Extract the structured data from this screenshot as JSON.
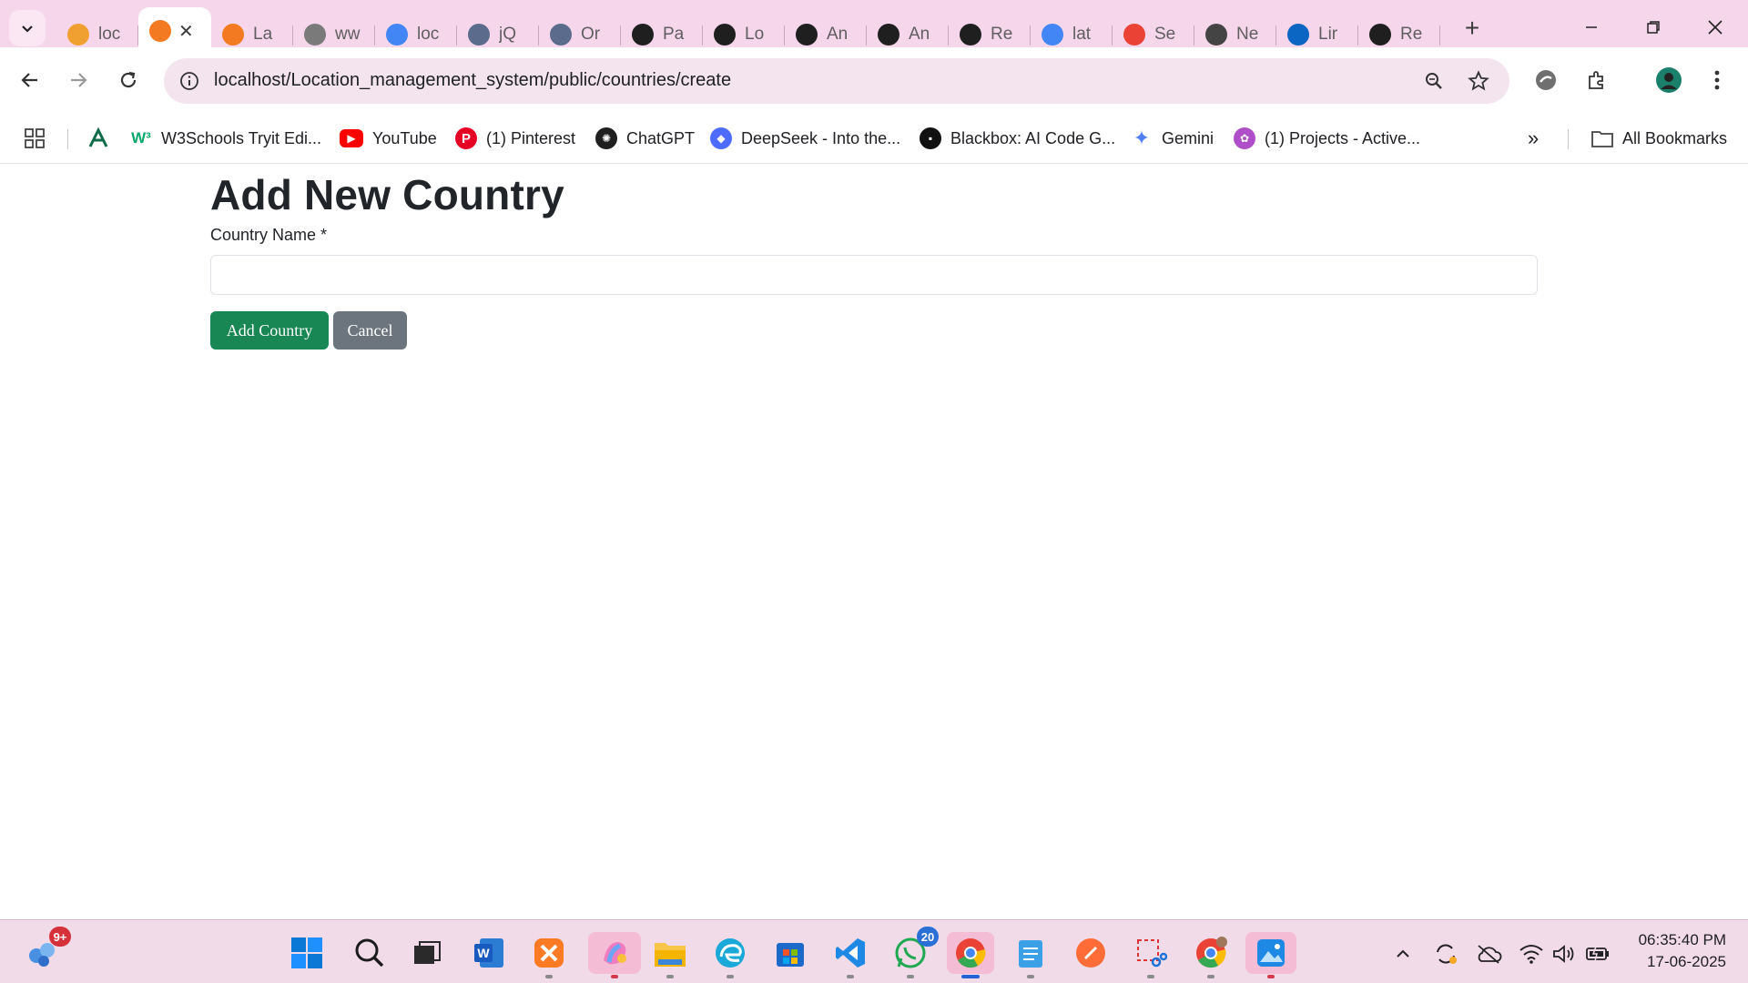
{
  "browser": {
    "tabs": [
      {
        "title": "loc",
        "icon": "phpmyadmin-icon",
        "color": "#f0a030"
      },
      {
        "title": "",
        "icon": "xampp-icon",
        "color": "#f37a20",
        "active": true
      },
      {
        "title": "La",
        "icon": "xampp-icon",
        "color": "#f37a20"
      },
      {
        "title": "ww",
        "icon": "globe-icon",
        "color": "#7a7a7a"
      },
      {
        "title": "loc",
        "icon": "google-icon",
        "color": "#4285f4"
      },
      {
        "title": "jQ",
        "icon": "owl-icon",
        "color": "#5a6b8c"
      },
      {
        "title": "Or",
        "icon": "owl-icon",
        "color": "#5a6b8c"
      },
      {
        "title": "Pa",
        "icon": "openai-icon",
        "color": "#1f1f1f"
      },
      {
        "title": "Lo",
        "icon": "github-icon",
        "color": "#1f1f1f"
      },
      {
        "title": "An",
        "icon": "github-icon",
        "color": "#1f1f1f"
      },
      {
        "title": "An",
        "icon": "github-icon",
        "color": "#1f1f1f"
      },
      {
        "title": "Re",
        "icon": "github-icon",
        "color": "#1f1f1f"
      },
      {
        "title": "lat",
        "icon": "google-icon",
        "color": "#4285f4"
      },
      {
        "title": "Se",
        "icon": "gmail-icon",
        "color": "#ea4335"
      },
      {
        "title": "Ne",
        "icon": "chatgpt-icon",
        "color": "#444444"
      },
      {
        "title": "Lir",
        "icon": "linkedin-icon",
        "color": "#0a66c2"
      },
      {
        "title": "Re",
        "icon": "github-icon",
        "color": "#1f1f1f"
      }
    ],
    "active_tab_close": "✕",
    "new_tab": "+",
    "url": "localhost/Location_management_system/public/countries/create",
    "bookmarks": [
      {
        "label": "",
        "icon": "apps-icon"
      },
      {
        "label": "",
        "icon": "a-logo-icon"
      },
      {
        "label": "W3Schools Tryit Edi...",
        "icon": "w3schools-icon",
        "color": "#04aa6d"
      },
      {
        "label": "YouTube",
        "icon": "youtube-icon",
        "color": "#ff0000"
      },
      {
        "label": "(1) Pinterest",
        "icon": "pinterest-icon",
        "color": "#e60023"
      },
      {
        "label": "ChatGPT",
        "icon": "chatgpt-icon",
        "color": "#1f1f1f"
      },
      {
        "label": "DeepSeek - Into the...",
        "icon": "deepseek-icon",
        "color": "#4d6bfe"
      },
      {
        "label": "Blackbox: AI Code G...",
        "icon": "blackbox-icon",
        "color": "#111111"
      },
      {
        "label": "Gemini",
        "icon": "gemini-icon",
        "color": "#4f7ef7"
      },
      {
        "label": "(1) Projects - Active...",
        "icon": "projects-icon",
        "color": "#b04dc8"
      }
    ],
    "all_bookmarks": "All Bookmarks",
    "more_bookmarks": "»"
  },
  "page": {
    "title": "Add New Country",
    "field_label": "Country Name *",
    "field_value": "",
    "submit_label": "Add Country",
    "cancel_label": "Cancel"
  },
  "colors": {
    "primary": "#198754",
    "secondary": "#6c757d",
    "tabstrip": "#f6d6ea"
  },
  "taskbar": {
    "notification_badge": "9+",
    "whatsapp_badge": "20",
    "time": "06:35:40 PM",
    "date": "17-06-2025"
  }
}
